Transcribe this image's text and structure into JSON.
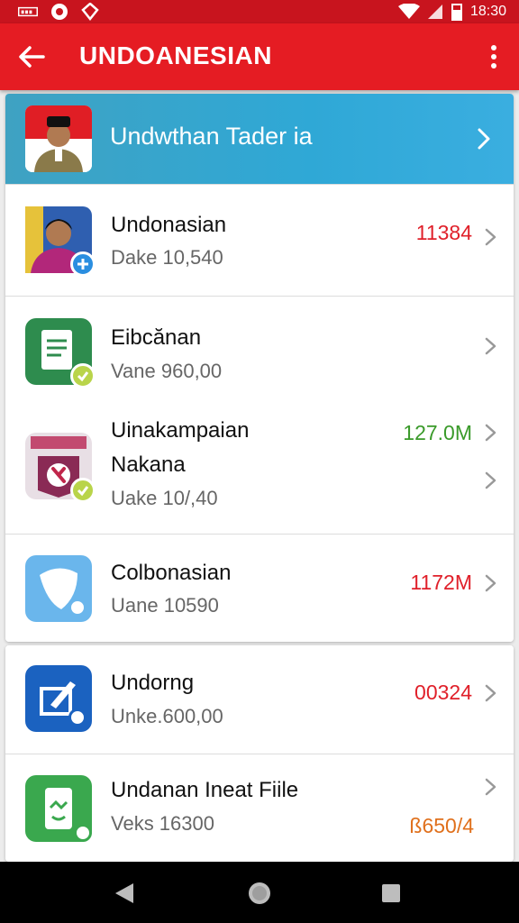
{
  "status_bar": {
    "time": "18:30"
  },
  "app_bar": {
    "title": "UNDOANESIAN"
  },
  "featured": {
    "title": "Undwthan Tader ia"
  },
  "items": [
    {
      "name": "Undonasian",
      "sub": "Dake 10,540",
      "amount": "11384"
    },
    {
      "name": "Eibcănan",
      "sub": "Vane 960,00",
      "amount": ""
    },
    {
      "name": "Uinakampaian",
      "name2": "Nakana",
      "sub": "Uake 10/,40",
      "amount": "127.0M"
    },
    {
      "name": "Colbonasian",
      "sub": "Uane 10590",
      "amount": "1172M"
    },
    {
      "name": "Undorng",
      "sub": "Unke.600,00",
      "amount": "00324"
    },
    {
      "name": "Undanan Ineat Fiile",
      "sub": "Veks 16300",
      "amount": "ß650/4"
    }
  ],
  "colors": {
    "status_bar": "#c8141e",
    "app_bar": "#e51c23",
    "featured": "#2fa8d6",
    "amount_red": "#e0202a",
    "amount_green": "#3a9a2a",
    "amount_orange": "#e0701c"
  }
}
